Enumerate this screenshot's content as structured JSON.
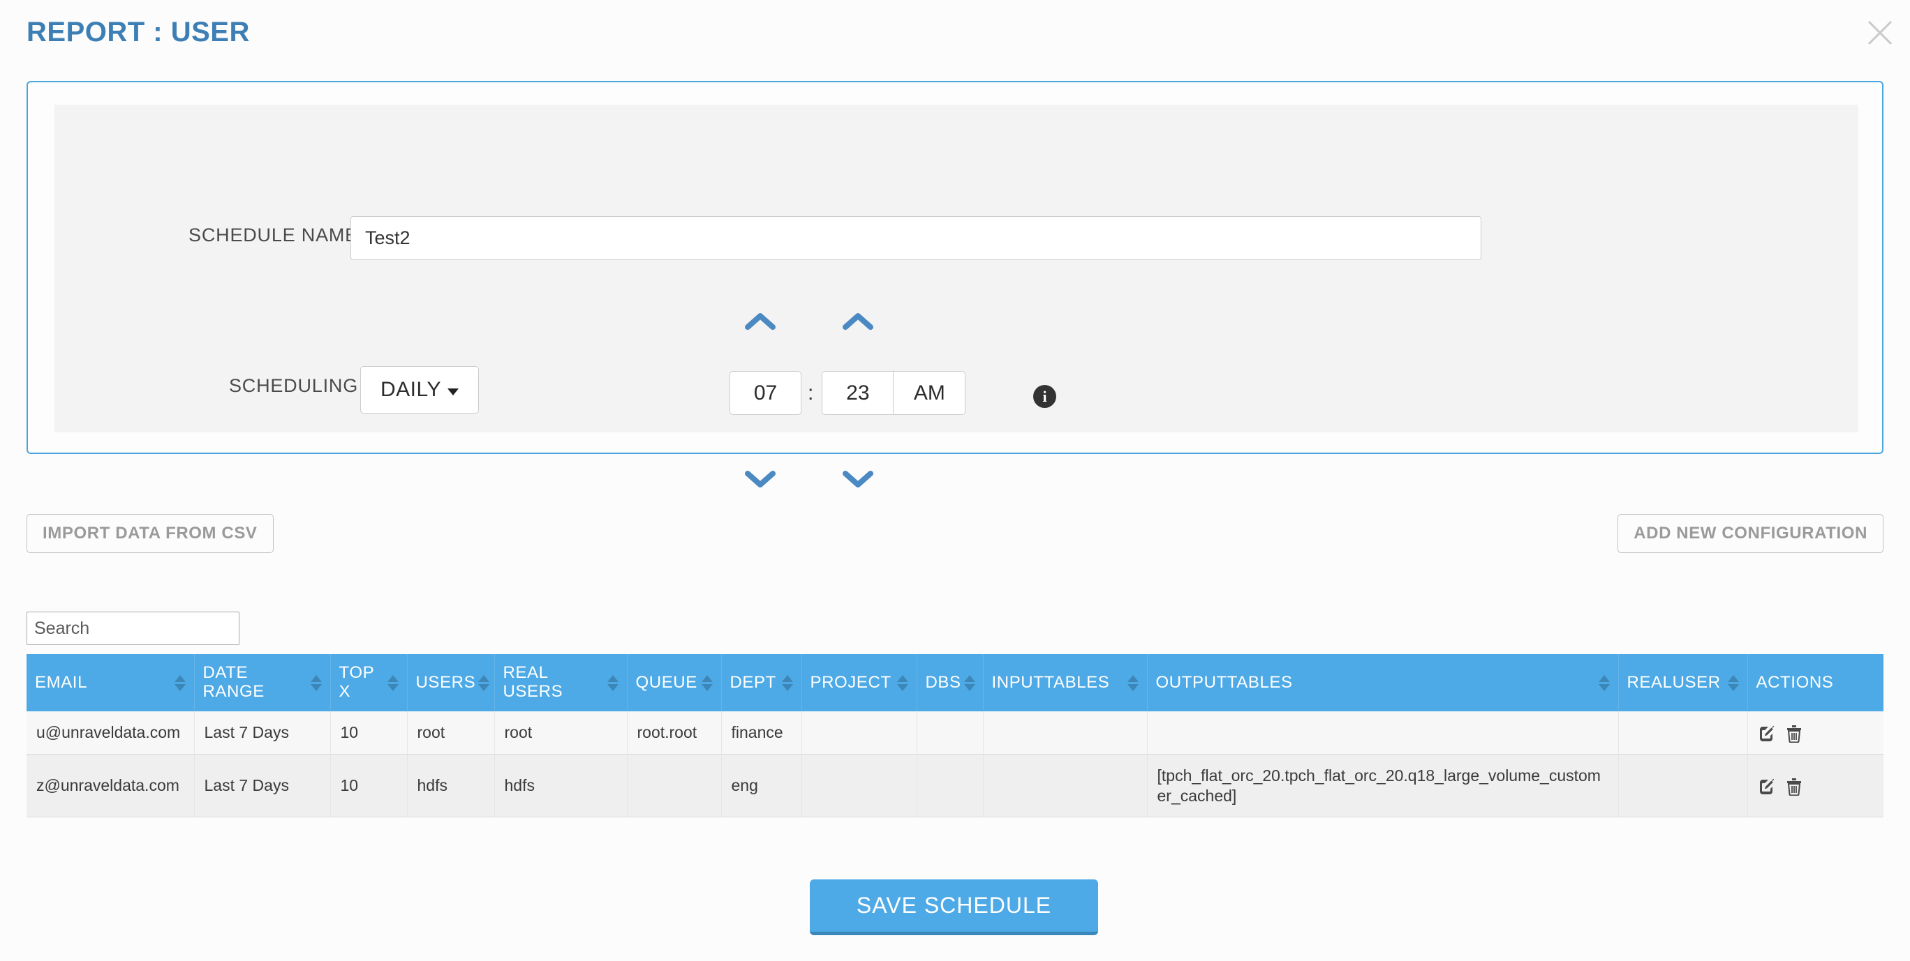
{
  "header": {
    "title": "REPORT : USER",
    "close_icon": "close-icon"
  },
  "schedule_form": {
    "schedule_name_label": "SCHEDULE NAME",
    "schedule_name_value": "Test2",
    "scheduling_label": "SCHEDULING",
    "frequency_value": "DAILY",
    "time": {
      "hour": "07",
      "separator": ":",
      "minute": "23",
      "meridiem": "AM"
    },
    "info_icon_glyph": "i",
    "info_icon": "info-icon"
  },
  "toolbar": {
    "import_label": "IMPORT DATA FROM CSV",
    "add_config_label": "ADD NEW CONFIGURATION"
  },
  "search": {
    "placeholder": "Search",
    "value": ""
  },
  "table": {
    "columns": [
      {
        "label": "EMAIL",
        "sortable": true
      },
      {
        "label": "DATE RANGE",
        "sortable": true
      },
      {
        "label": "TOP X",
        "sortable": true
      },
      {
        "label": "USERS",
        "sortable": true
      },
      {
        "label": "REAL USERS",
        "sortable": true
      },
      {
        "label": "QUEUE",
        "sortable": true
      },
      {
        "label": "DEPT",
        "sortable": true
      },
      {
        "label": "PROJECT",
        "sortable": true
      },
      {
        "label": "DBS",
        "sortable": true
      },
      {
        "label": "INPUTTABLES",
        "sortable": true
      },
      {
        "label": "OUTPUTTABLES",
        "sortable": true
      },
      {
        "label": "REALUSER",
        "sortable": true
      },
      {
        "label": "ACTIONS",
        "sortable": false
      }
    ],
    "rows": [
      {
        "email": "u@unraveldata.com",
        "date_range": "Last 7 Days",
        "top_x": "10",
        "users": "root",
        "real_users": "root",
        "queue": "root.root",
        "dept": "finance",
        "project": "",
        "dbs": "",
        "inputtables": "",
        "outputtables": "",
        "realuser": "",
        "actions": [
          "edit-icon",
          "delete-icon"
        ]
      },
      {
        "email": "z@unraveldata.com",
        "date_range": "Last 7 Days",
        "top_x": "10",
        "users": "hdfs",
        "real_users": "hdfs",
        "queue": "",
        "dept": "eng",
        "project": "",
        "dbs": "",
        "inputtables": "",
        "outputtables": "[tpch_flat_orc_20.tpch_flat_orc_20.q18_large_volume_customer_cached]",
        "realuser": "",
        "actions": [
          "edit-icon",
          "delete-icon"
        ]
      }
    ]
  },
  "footer": {
    "save_label": "SAVE SCHEDULE"
  },
  "colors": {
    "accent_blue": "#4eaae6",
    "title_blue": "#3d7fb5",
    "panel_border": "#4ba6e0",
    "chevron_blue": "#4a89c2"
  }
}
